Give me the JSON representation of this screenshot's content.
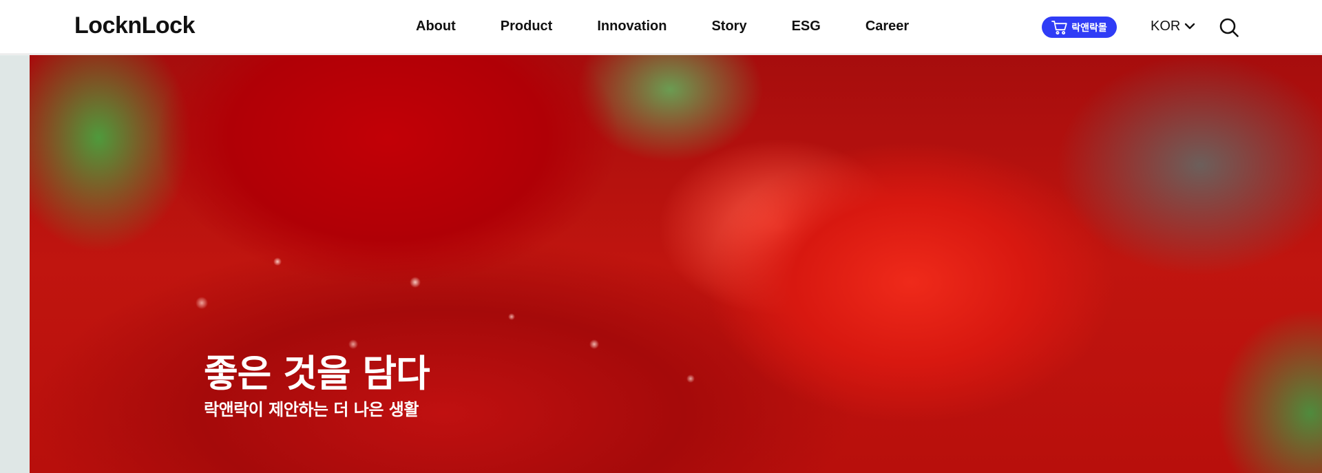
{
  "header": {
    "logo": "LocknLock",
    "nav": [
      {
        "label": "About"
      },
      {
        "label": "Product"
      },
      {
        "label": "Innovation"
      },
      {
        "label": "Story"
      },
      {
        "label": "ESG"
      },
      {
        "label": "Career"
      }
    ],
    "shop_button": {
      "label": "락앤락몰",
      "icon": "cart-icon"
    },
    "language": {
      "label": "KOR",
      "icon": "chevron-down-icon"
    },
    "search": {
      "icon": "search-icon"
    }
  },
  "hero": {
    "title": "좋은 것을 담다",
    "subtitle": "락앤락이 제안하는 더 나은 생활"
  },
  "colors": {
    "accent": "#2f3cf6",
    "text": "#111111",
    "hero_text": "#ffffff"
  }
}
